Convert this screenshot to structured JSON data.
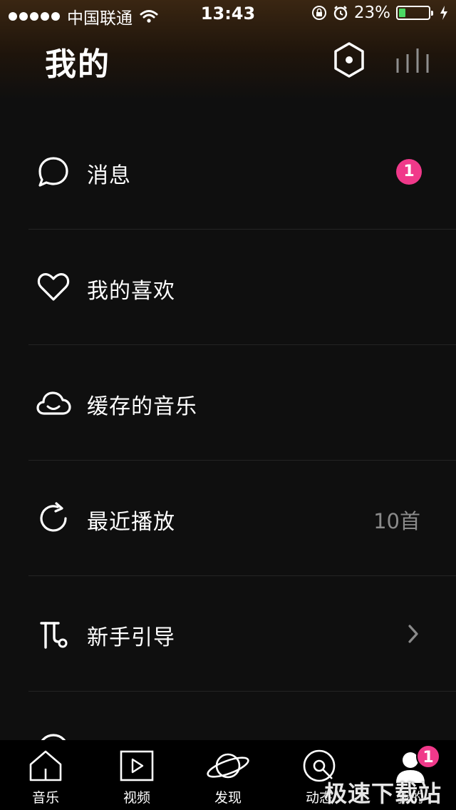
{
  "status_bar": {
    "carrier": "中国联通",
    "time": "13:43",
    "battery_percent": "23%",
    "battery_level": 0.23,
    "icons": [
      "signal-dots-icon",
      "wifi-icon",
      "rotation-lock-icon",
      "alarm-icon",
      "battery-icon",
      "charging-icon"
    ]
  },
  "header": {
    "title": "我的",
    "actions": [
      "settings-hexagon-icon",
      "equalizer-bars-icon"
    ]
  },
  "menu": {
    "items": [
      {
        "label": "消息",
        "icon": "message-bubble-icon",
        "badge": "1"
      },
      {
        "label": "我的喜欢",
        "icon": "heart-icon"
      },
      {
        "label": "缓存的音乐",
        "icon": "cloud-icon"
      },
      {
        "label": "最近播放",
        "icon": "refresh-icon",
        "right_text": "10首"
      },
      {
        "label": "新手引导",
        "icon": "guide-icon",
        "chevron": "chevron-right-icon"
      }
    ]
  },
  "tab_bar": {
    "tabs": [
      {
        "label": "音乐",
        "icon": "home-icon"
      },
      {
        "label": "视频",
        "icon": "video-play-icon"
      },
      {
        "label": "发现",
        "icon": "planet-icon"
      },
      {
        "label": "动态",
        "icon": "disc-icon"
      },
      {
        "label": "我的",
        "icon": "user-icon",
        "badge": "1"
      }
    ]
  },
  "watermark": "极速下载站",
  "colors": {
    "background": "#0f0f0f",
    "badge": "#f0398a",
    "battery": "#4cd964",
    "secondary_text": "#8a8a8a",
    "header_gradient_top": "#3a2612"
  }
}
